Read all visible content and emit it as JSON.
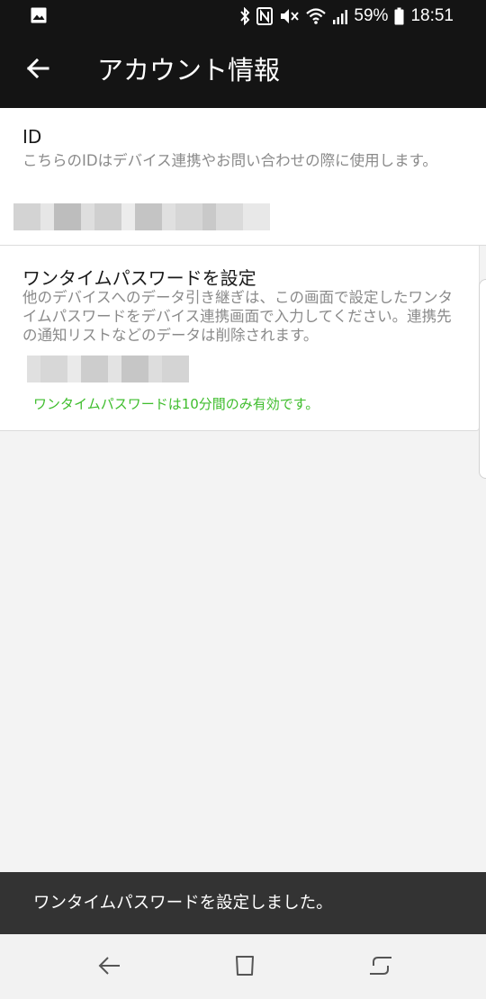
{
  "status_bar": {
    "battery": "59%",
    "time": "18:51",
    "icons": [
      "image-icon",
      "bluetooth-icon",
      "nfc-icon",
      "mute-icon",
      "wifi-icon",
      "signal-icon",
      "battery-icon"
    ]
  },
  "app_bar": {
    "title": "アカウント情報",
    "back_icon": "arrow-left-icon"
  },
  "id_section": {
    "title": "ID",
    "description": "こちらのIDはデバイス連携やお問い合わせの際に使用します。"
  },
  "otp_section": {
    "title": "ワンタイムパスワードを設定",
    "description": "他のデバイスへのデータ引き継ぎは、この画面で設定したワンタイムパスワードをデバイス連携画面で入力してください。連携先の通知リストなどのデータは削除されます。",
    "note": "ワンタイムパスワードは10分間のみ有効です。",
    "note_color": "#3ebd2c"
  },
  "snackbar": {
    "message": "ワンタイムパスワードを設定しました。"
  },
  "nav_bar": {
    "icons": [
      "back-nav-icon",
      "home-nav-icon",
      "recents-nav-icon"
    ]
  }
}
